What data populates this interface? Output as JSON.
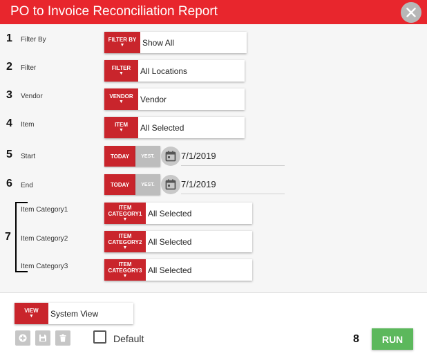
{
  "header": {
    "title": "PO to Invoice Reconciliation Report",
    "close_icon": "close-icon"
  },
  "filters": {
    "filter_by": {
      "number": "1",
      "label": "Filter By",
      "tag": "FILTER BY",
      "value": "Show All"
    },
    "filter": {
      "number": "2",
      "label": "Filter",
      "tag": "FILTER",
      "value": "All Locations"
    },
    "vendor": {
      "number": "3",
      "label": "Vendor",
      "tag": "VENDOR",
      "value": "Vendor"
    },
    "item": {
      "number": "4",
      "label": "Item",
      "tag": "ITEM",
      "value": "All Selected"
    },
    "start": {
      "number": "5",
      "label": "Start",
      "today": "TODAY",
      "yest": "YEST.",
      "value": "7/1/2019"
    },
    "end": {
      "number": "6",
      "label": "End",
      "today": "TODAY",
      "yest": "YEST.",
      "value": "7/1/2019"
    },
    "categories": {
      "number": "7",
      "items": [
        {
          "label": "Item Category1",
          "tag_line1": "ITEM",
          "tag_line2": "CATEGORY1",
          "value": "All Selected"
        },
        {
          "label": "Item Category2",
          "tag_line1": "ITEM",
          "tag_line2": "CATEGORY2",
          "value": "All Selected"
        },
        {
          "label": "Item Category3",
          "tag_line1": "ITEM",
          "tag_line2": "CATEGORY3",
          "value": "All Selected"
        }
      ]
    }
  },
  "footer": {
    "view_tag": "VIEW",
    "view_value": "System View",
    "default_label": "Default",
    "number": "8",
    "run_label": "RUN"
  },
  "arrow_glyph": "▼",
  "colors": {
    "header": "#e8262d",
    "tag": "#c9252c",
    "run": "#5cb85c",
    "yest": "#bdbdbd"
  }
}
